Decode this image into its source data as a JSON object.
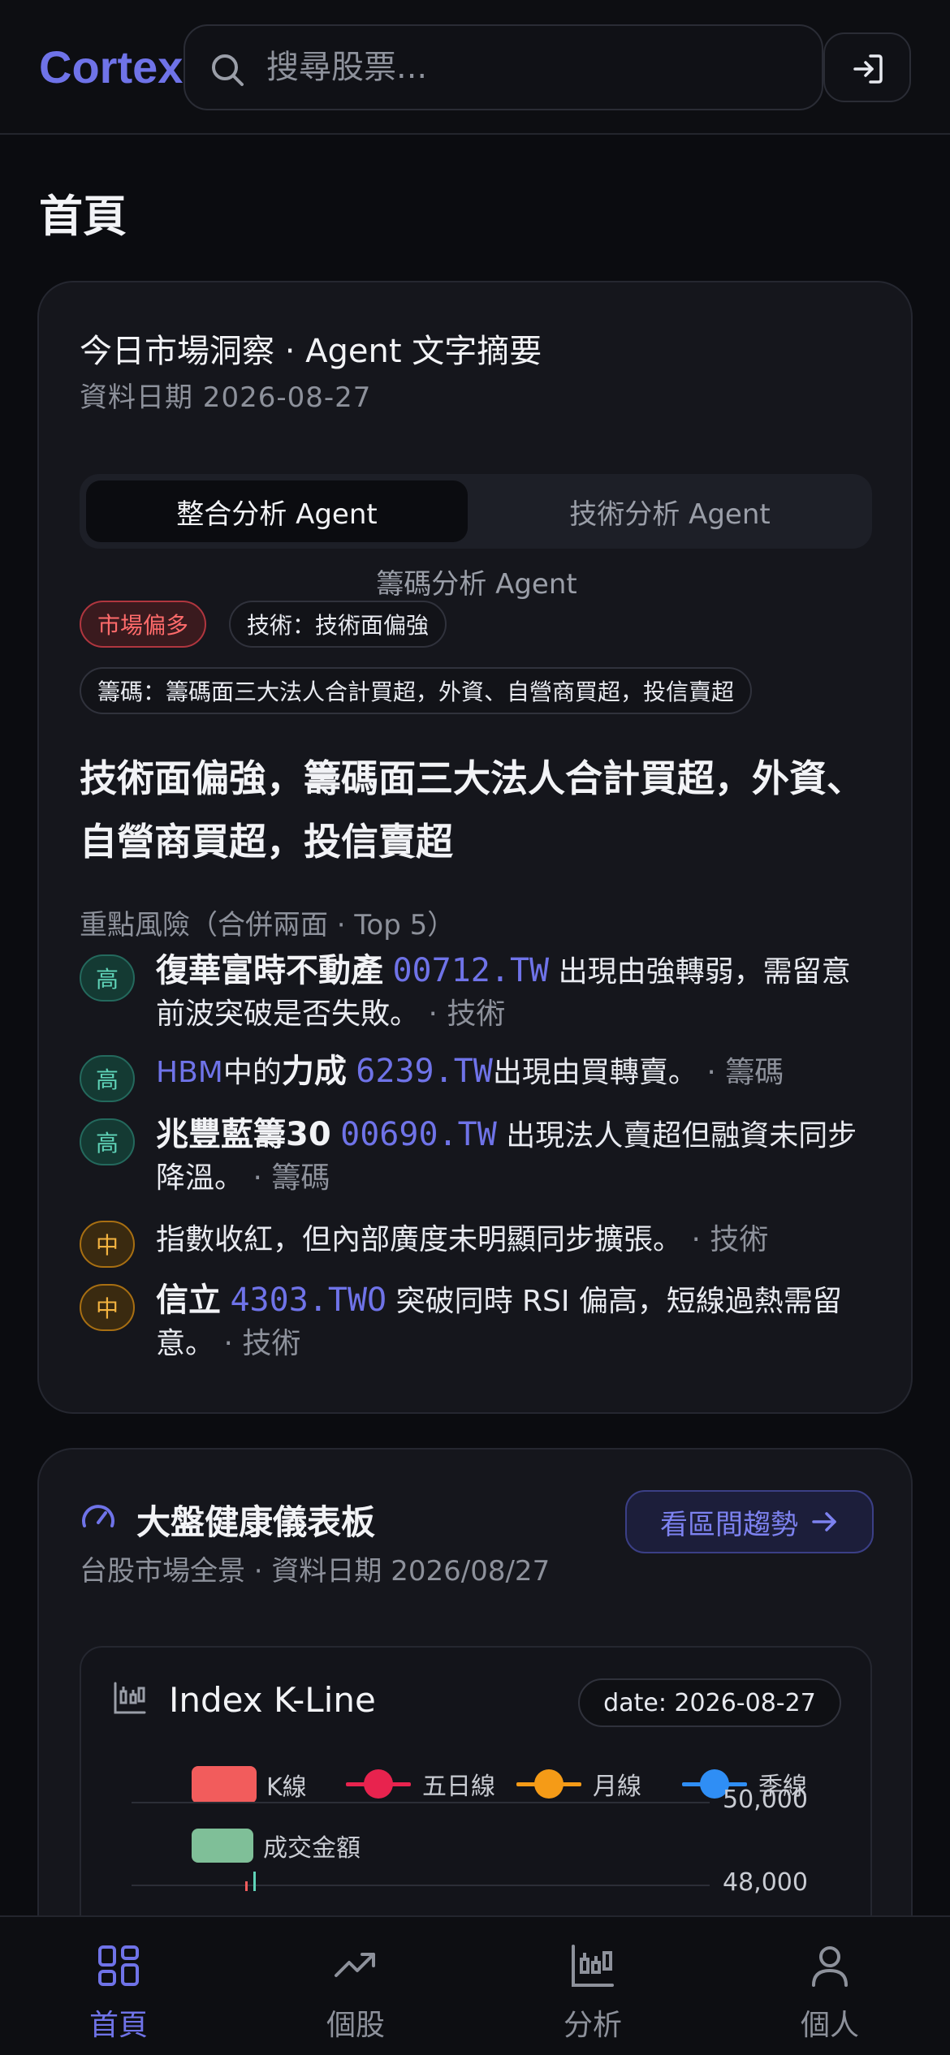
{
  "header": {
    "logo": "Cortex",
    "search_placeholder": "搜尋股票..."
  },
  "page": {
    "title": "首頁"
  },
  "insight_card": {
    "title": "今日市場洞察 · Agent 文字摘要",
    "date": "資料日期 2026-08-27",
    "tabs": [
      "整合分析 Agent",
      "技術分析 Agent",
      "籌碼分析 Agent"
    ],
    "active_tab": "整合分析 Agent",
    "pills": {
      "sentiment": "市場偏多",
      "technical": "技術：技術面偏強",
      "chips": "籌碼：籌碼面三大法人合計買超，外資、自營商買超，投信賣超"
    },
    "headline": "技術面偏強，籌碼面三大法人合計買超，外資、自營商買超，投信賣超",
    "risk_label": "重點風險（合併兩面 · Top 5）",
    "risks": [
      {
        "level": "高",
        "name": "復華富時不動產",
        "ticker": "00712.TW",
        "text": "出現由強轉弱，需留意前波突破是否失敗。",
        "tag": "· 技術"
      },
      {
        "level": "高",
        "prefix": "HBM",
        "mid": "中的",
        "name": "力成",
        "ticker": "6239.TW",
        "text": "出現由買轉賣。",
        "tag": "· 籌碼"
      },
      {
        "level": "高",
        "name": "兆豐藍籌30",
        "ticker": "00690.TW",
        "text": "出現法人賣超但融資未同步降溫。",
        "tag": "· 籌碼"
      },
      {
        "level": "中",
        "text": "指數收紅，但內部廣度未明顯同步擴張。",
        "tag": "· 技術"
      },
      {
        "level": "中",
        "name": "信立",
        "ticker": "4303.TWO",
        "text": "突破同時 RSI 偏高，短線過熱需留意。",
        "tag": "· 技術"
      }
    ]
  },
  "dashboard_card": {
    "title": "大盤健康儀表板",
    "subtitle": "台股市場全景 · 資料日期 2026/08/27",
    "trend_button": "看區間趨勢",
    "kline": {
      "title": "Index K-Line",
      "date_pill": "date: 2026-08-27",
      "legend": {
        "k": "K線",
        "ma5": "五日線",
        "month": "月線",
        "quarter": "季線",
        "volume": "成交金額"
      },
      "y_ticks": [
        "50,000",
        "48,000"
      ]
    }
  },
  "colors": {
    "accent": "#6f73e8",
    "k_up": "#f25c5c",
    "ma5": "#e8234e",
    "month": "#f59b17",
    "quarter": "#2f8ef5",
    "volume": "#7fbf98"
  },
  "nav": [
    {
      "label": "首頁",
      "icon": "grid-icon",
      "active": true
    },
    {
      "label": "個股",
      "icon": "trend-icon",
      "active": false
    },
    {
      "label": "分析",
      "icon": "candlestick-icon",
      "active": false
    },
    {
      "label": "個人",
      "icon": "user-icon",
      "active": false
    }
  ]
}
